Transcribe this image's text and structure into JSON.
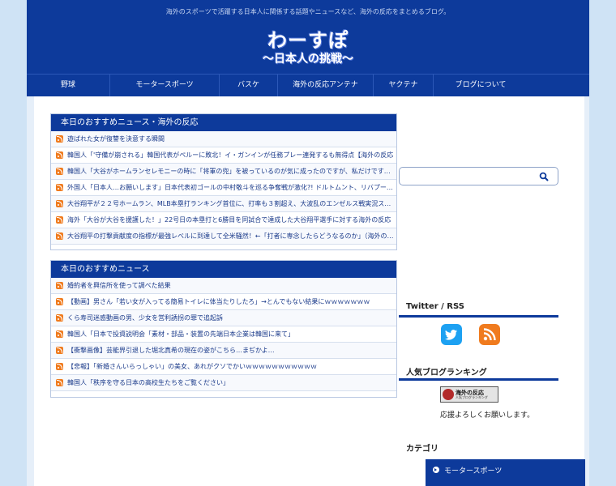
{
  "header": {
    "tagline": "海外のスポーツで活躍する日本人に関係する話題やニュースなど、海外の反応をまとめるブログ。",
    "logo_main": "わーすぽ",
    "logo_sub": "〜日本人の挑戦〜"
  },
  "nav": [
    "野球",
    "モータースポーツ",
    "バスケ",
    "海外の反応アンテナ",
    "ヤクテナ",
    "ブログについて"
  ],
  "box1": {
    "title": "本日のおすすめニュース・海外の反応",
    "items": [
      "遊ばれた女が復讐を決意する瞬間",
      "韓国人「'守備が崩される」韓国代表がペルーに敗北！イ・ガンインが任務プレー連発するも無得点【海外の反応",
      "韓国人「大谷がホームランセレモニーの時に「将軍の兜」を被っているのが気に成ったのですが、私だけですか？...",
      "外国人「日本人…お願いします」日本代表初ゴールの中村敬斗を巡る争奪戦が激化?! ドルトムント、リバプールな...",
      "大谷翔平が２２号ホームラン、MLB本塁打ランキング首位に、打率も３割超え、大波乱のエンゼルス戦実況スレ...",
      "海外「大谷が大谷を援護した！」22号日の本塁打と6勝目を同試合で達成した大谷翔平選手に対する海外の反応",
      "大谷翔平の打撃貢献度の指標が最強レベルに到達して全米騒然！←「打者に専念したらどうなるのか」（海外の反..."
    ]
  },
  "box2": {
    "title": "本日のおすすめニュース",
    "items": [
      "婚約者を興信所を使って調べた結果",
      "【動画】男さん「若い女が入ってる簡易トイレに体当たりしたろ」→とんでもない結果にｗｗｗｗｗｗｗ",
      "くら寿司迷惑動画の男、少女を営利誘拐の罪で追起訴",
      "韓国人「日本で投資説明会「素材・部品・装置の先端日本企業は韓国に来て」",
      "【衝撃画像】芸能界引退した堀北真希の現在の姿がこちら…まぢかよ…",
      "【悲報】「新婚さんいらっしゃい」の美女、あれがクソでかいｗｗｗｗｗｗｗｗｗｗｗ",
      "韓国人「秩序を守る日本の高校生たちをご覧ください」"
    ]
  },
  "sidebar": {
    "search_icon": "search-icon",
    "twitter_title": "Twitter / RSS",
    "ranking_title": "人気ブログランキング",
    "ranking_banner_line1": "海外の反応",
    "ranking_banner_line2": "人気ブログランキング",
    "cheer_text": "応援よろしくお願いします。",
    "category_title": "カテゴリ",
    "categories": [
      "モータースポーツ"
    ]
  },
  "colors": {
    "brand_blue": "#0d3a9b",
    "rss_orange": "#f07b1e",
    "twitter_blue": "#1da1f2"
  }
}
